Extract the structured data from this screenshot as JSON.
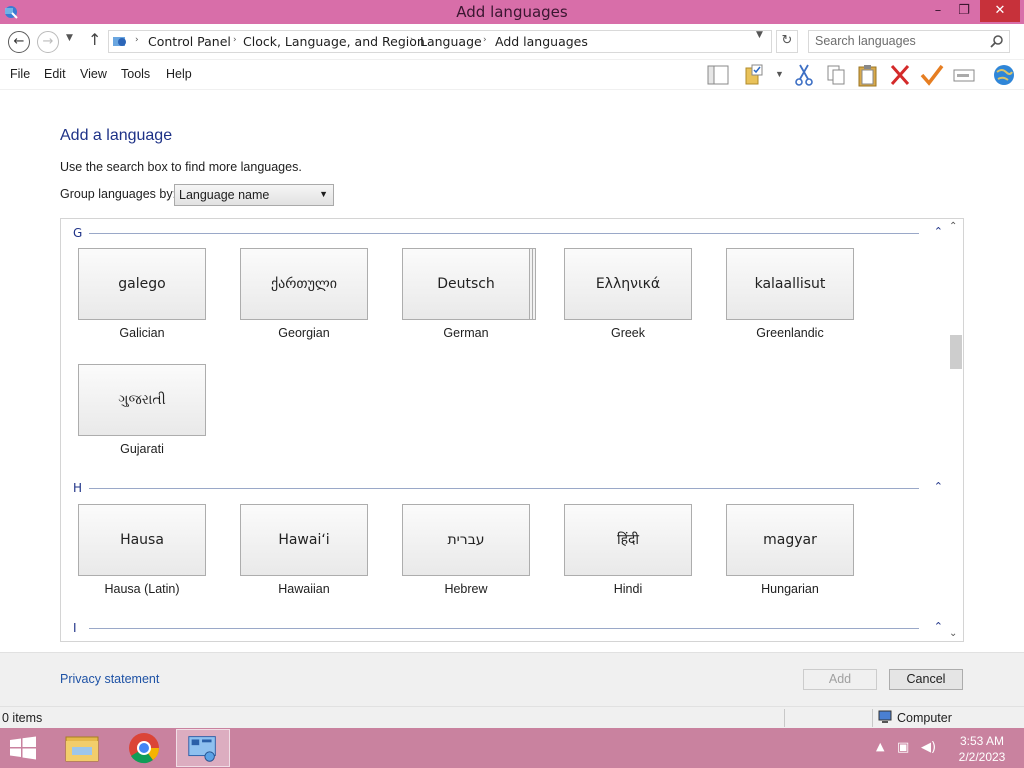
{
  "window": {
    "title": "Add languages",
    "minimize": "–",
    "maximize": "❐",
    "close": "✕"
  },
  "address": {
    "crumbs": [
      "Control Panel",
      "Clock, Language, and Region",
      "Language",
      "Add languages"
    ],
    "search_placeholder": "Search languages"
  },
  "menu": {
    "items": [
      "File",
      "Edit",
      "View",
      "Tools",
      "Help"
    ]
  },
  "toolbar": {
    "icons": [
      "layout-icon",
      "properties-icon",
      "cut-icon",
      "copy-icon",
      "paste-icon",
      "delete-icon",
      "checkmark-icon",
      "rename-icon",
      "globe-icon"
    ]
  },
  "content": {
    "title": "Add a language",
    "hint": "Use the search box to find more languages.",
    "group_label": "Group languages by:",
    "group_value": "Language name"
  },
  "groups": [
    {
      "letter": "G",
      "languages": [
        {
          "native": "galego",
          "name": "Galician"
        },
        {
          "native": "ქართული",
          "name": "Georgian"
        },
        {
          "native": "Deutsch",
          "name": "German"
        },
        {
          "native": "Ελληνικά",
          "name": "Greek"
        },
        {
          "native": "kalaallisut",
          "name": "Greenlandic"
        },
        {
          "native": "ગુજરાતી",
          "name": "Gujarati"
        }
      ]
    },
    {
      "letter": "H",
      "languages": [
        {
          "native": "Hausa",
          "name": "Hausa (Latin)"
        },
        {
          "native": "Hawaiʻi",
          "name": "Hawaiian"
        },
        {
          "native": "עברית",
          "name": "Hebrew"
        },
        {
          "native": "हिंदी",
          "name": "Hindi"
        },
        {
          "native": "magyar",
          "name": "Hungarian"
        }
      ]
    },
    {
      "letter": "I",
      "languages": []
    }
  ],
  "footer": {
    "privacy": "Privacy statement",
    "add": "Add",
    "cancel": "Cancel"
  },
  "status": {
    "items": "0 items",
    "location": "Computer"
  },
  "taskbar": {
    "time": "3:53 AM",
    "date": "2/2/2023"
  },
  "colors": {
    "titlebar": "#d86ea9",
    "taskbar": "#c9829f",
    "heading": "#1e3287",
    "link": "#1e52a5"
  }
}
